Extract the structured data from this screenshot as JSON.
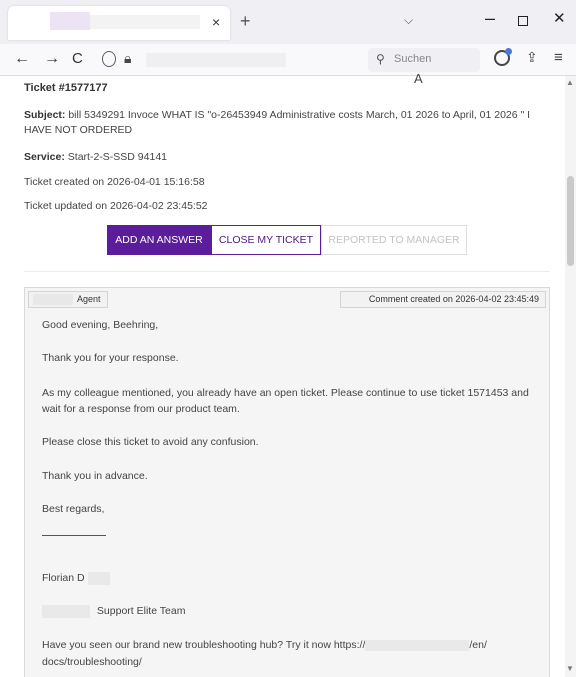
{
  "browser": {
    "tab_close": "×",
    "new_tab": "+",
    "tab_list": "⌵",
    "window_min": "–",
    "window_close": "✕",
    "nav_back": "←",
    "nav_forward": "→",
    "nav_reload": "C",
    "search_placeholder": "Suchen",
    "icons": [
      "close-icon",
      "plus-icon",
      "chevron-down-icon",
      "minimize-icon",
      "maximize-icon",
      "back-icon",
      "forward-icon",
      "reload-icon",
      "shield-icon",
      "lock-icon",
      "reader-view-icon",
      "translate-icon",
      "star-icon",
      "search-icon",
      "extension-icon",
      "share-icon",
      "menu-icon"
    ]
  },
  "ticket": {
    "id_label": "Ticket #1577177",
    "subject_label": "Subject:",
    "subject_text": "bill 5349291 Invoce WHAT IS \"o-26453949 Administrative costs March, 01 2026 to April, 01 2026 \" I HAVE NOT ORDERED",
    "service_label": "Service:",
    "service_text": "Start-2-S-SSD 94141",
    "created": "Ticket created on 2026-04-01 15:16:58",
    "updated": "Ticket updated on 2026-04-02 23:45:52"
  },
  "actions": {
    "add_answer": "ADD AN ANSWER",
    "close_ticket": "CLOSE MY TICKET",
    "reported": "REPORTED TO MANAGER"
  },
  "comment": {
    "author_role": "Agent",
    "created": "Comment created on 2026-04-02 23:45:49",
    "lines": {
      "greeting": "Good evening, Beehring,",
      "thanks": "Thank you for your response.",
      "para1": "As my colleague mentioned, you already have an open ticket. Please continue to use ticket 1571453 and wait for a response from our product team.",
      "para2": "Please close this ticket to avoid any confusion.",
      "thanks_adv": "Thank you in advance.",
      "regards": "Best regards,",
      "name": "Florian D",
      "team": "Support Elite Team",
      "promo_prefix": "Have you seen our brand new troubleshooting hub? Try it now https://",
      "promo_suffix": "/en/",
      "promo_line2": "docs/troubleshooting/"
    }
  },
  "colors": {
    "accent": "#5b1d9c",
    "comment_bg": "#f5f5f5",
    "disabled_text": "#c3c3c3"
  }
}
